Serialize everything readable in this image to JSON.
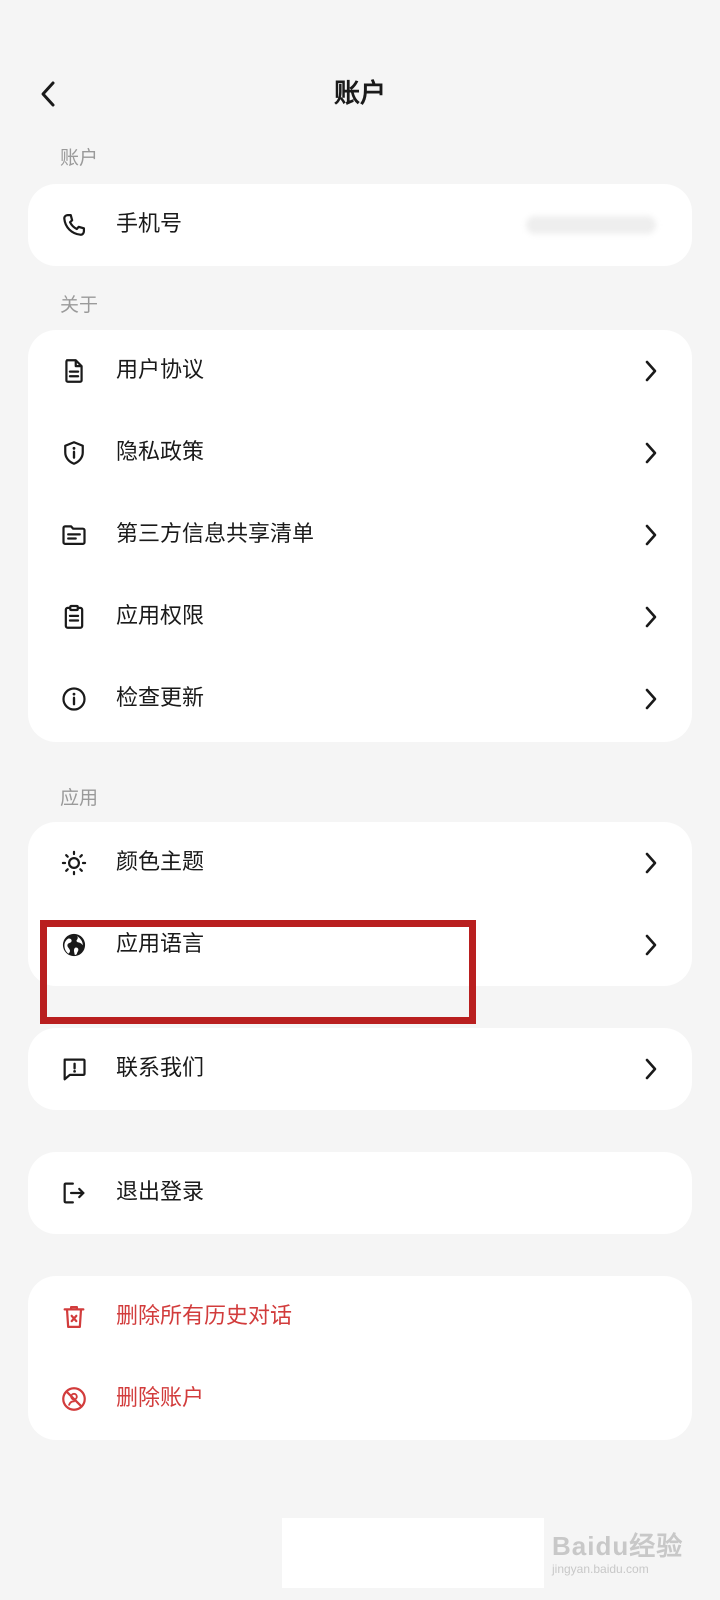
{
  "header": {
    "title": "账户"
  },
  "sections": {
    "account": "账户",
    "about": "关于",
    "app": "应用"
  },
  "account_card": {
    "phone_label": "手机号"
  },
  "about_card": {
    "items": [
      {
        "label": "用户协议",
        "icon": "document-icon"
      },
      {
        "label": "隐私政策",
        "icon": "shield-info-icon"
      },
      {
        "label": "第三方信息共享清单",
        "icon": "folder-list-icon"
      },
      {
        "label": "应用权限",
        "icon": "clipboard-icon"
      },
      {
        "label": "检查更新",
        "icon": "info-circle-icon"
      }
    ]
  },
  "app_card": {
    "items": [
      {
        "label": "颜色主题",
        "icon": "sun-icon"
      },
      {
        "label": "应用语言",
        "icon": "globe-icon"
      }
    ]
  },
  "contact_card": {
    "label": "联系我们",
    "icon": "feedback-icon"
  },
  "logout_card": {
    "label": "退出登录",
    "icon": "logout-icon"
  },
  "danger_card": {
    "items": [
      {
        "label": "删除所有历史对话",
        "icon": "trash-icon"
      },
      {
        "label": "删除账户",
        "icon": "no-user-icon"
      }
    ]
  },
  "colors": {
    "background": "#f5f5f5",
    "card": "#ffffff",
    "danger": "#d23c3c",
    "highlight": "#b91f1f"
  },
  "watermark": {
    "main": "Baidu经验",
    "sub": "jingyan.baidu.com"
  }
}
